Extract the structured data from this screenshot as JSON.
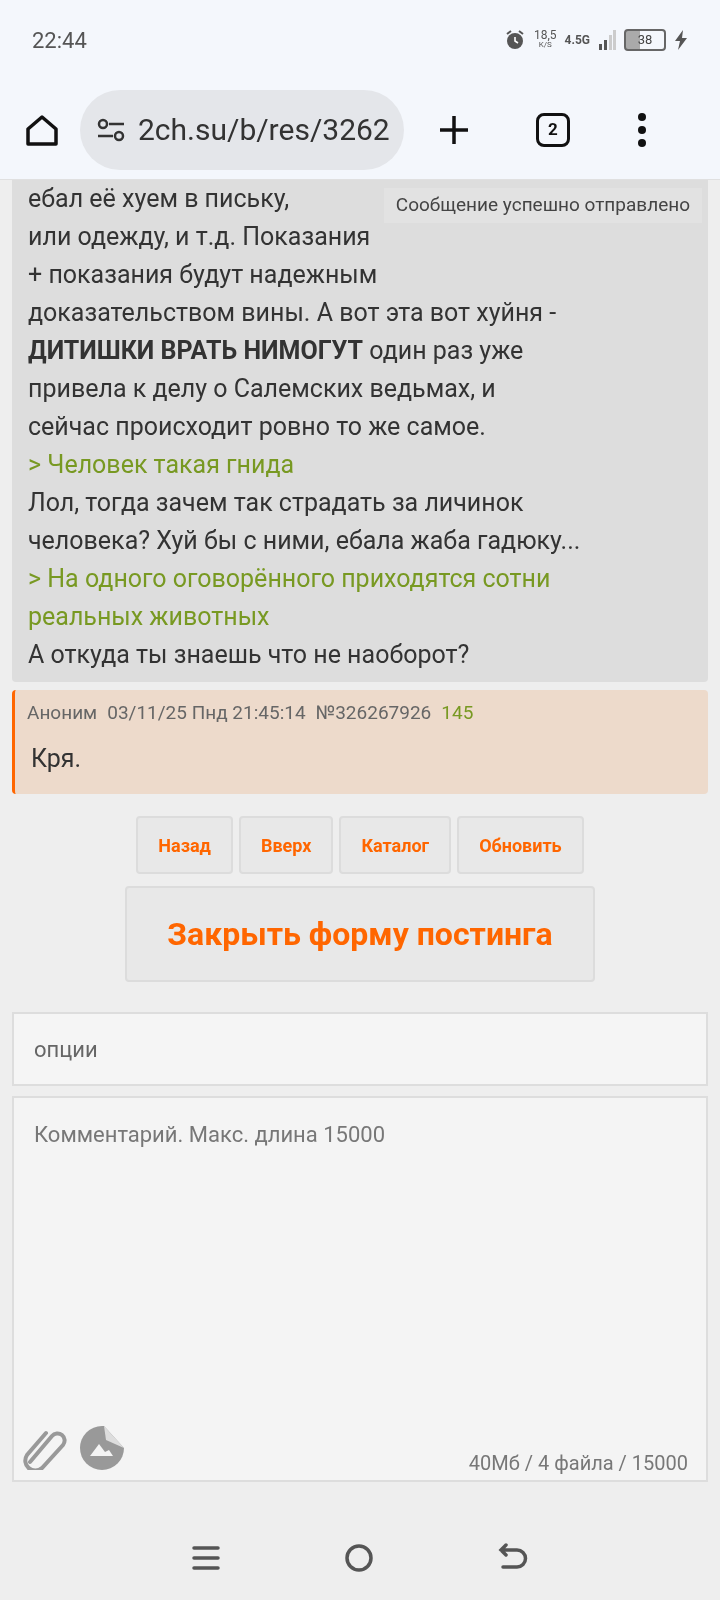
{
  "status_bar": {
    "time": "22:44",
    "speed": "18,5",
    "speed_unit": "K/S",
    "network": "4.5G",
    "battery": "38"
  },
  "browser": {
    "url": "2ch.su/b/res/3262",
    "tab_count": "2"
  },
  "toast": "Сообщение успешно отправлено",
  "posts": [
    {
      "kind": "body",
      "segments": [
        {
          "kind": "text",
          "lines": [
            "ебал её хуем в письку,",
            "или одежду, и т.д. Показания",
            "+ показания будут надежным",
            "доказательством вины. А вот эта вот хуйня -",
            "**ДИТИШКИ ВРАТЬ НИМОГУТ** один раз уже",
            "привела к делу о Салемских ведьмах, и",
            "сейчас происходит ровно то же самое."
          ]
        },
        {
          "kind": "quote",
          "lines": [
            "> Человек такая гнида"
          ]
        },
        {
          "kind": "text",
          "lines": [
            "Лол, тогда зачем так страдать за личинок",
            "человека? Хуй бы с ними, ебала жаба гадюку..."
          ]
        },
        {
          "kind": "quote",
          "lines": [
            "> На одного оговорённого приходятся сотни",
            "реальных животных"
          ]
        },
        {
          "kind": "text",
          "lines": [
            "А откуда ты знаешь что не наоборот?"
          ]
        }
      ]
    },
    {
      "kind": "full",
      "name": "Аноним",
      "date": "03/11/25 Пнд 21:45:14",
      "number": "№326267926",
      "count": "145",
      "segments": [
        {
          "kind": "text",
          "lines": [
            "Кря."
          ]
        }
      ]
    }
  ],
  "nav_buttons": [
    "Назад",
    "Вверх",
    "Каталог",
    "Обновить"
  ],
  "close_form_button": "Закрыть форму постинга",
  "options": "опции",
  "comment": {
    "placeholder": "Комментарий. Макс. длина 15000",
    "limits": "40Мб / 4 файла / 15000"
  }
}
